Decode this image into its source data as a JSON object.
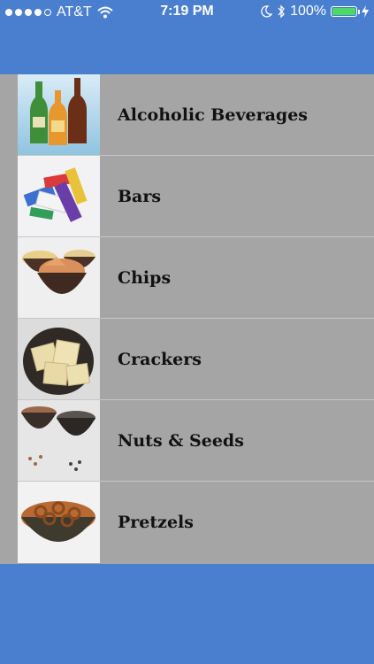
{
  "status_bar": {
    "carrier": "AT&T",
    "time": "7:19 PM",
    "battery": "100%"
  },
  "categories": [
    {
      "label": "Alcoholic Beverages",
      "icon": "beer-bottles-image"
    },
    {
      "label": "Bars",
      "icon": "snack-bars-image"
    },
    {
      "label": "Chips",
      "icon": "chips-bowl-image"
    },
    {
      "label": "Crackers",
      "icon": "crackers-bowl-image"
    },
    {
      "label": "Nuts & Seeds",
      "icon": "nuts-seeds-bowls-image"
    },
    {
      "label": "Pretzels",
      "icon": "pretzels-bowl-image"
    }
  ],
  "colors": {
    "nav_bar": "#4a7fcf",
    "list_background": "#a5a5a5",
    "separator": "#c7c7c7",
    "battery_fill": "#4cd964"
  }
}
